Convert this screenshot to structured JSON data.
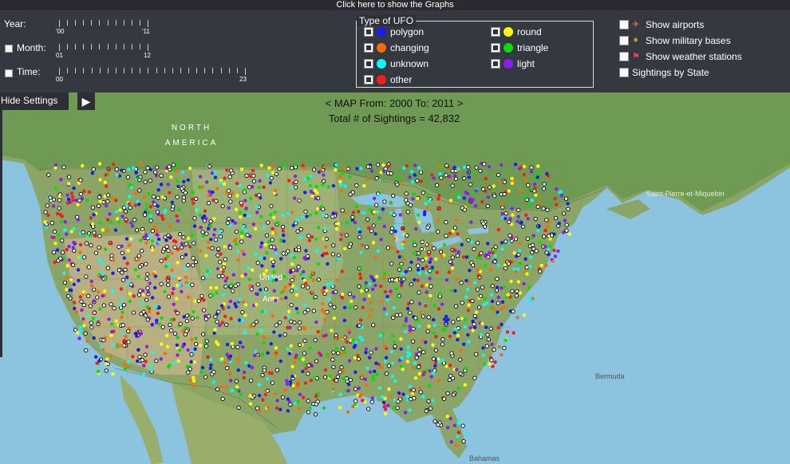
{
  "header": {
    "graphs_link": "Click here to show the Graphs"
  },
  "filters": {
    "year": {
      "label": "Year:",
      "min": "'00",
      "max": "'11"
    },
    "month": {
      "label": "Month:",
      "min": "01",
      "max": "12",
      "checked": false
    },
    "time": {
      "label": "Time:",
      "min": "00",
      "max": "23",
      "checked": false
    }
  },
  "ufo_types": {
    "legend": "Type of UFO",
    "items": [
      {
        "label": "polygon",
        "color": "#1a1aff"
      },
      {
        "label": "round",
        "color": "#ffff00"
      },
      {
        "label": "changing",
        "color": "#ff6a00"
      },
      {
        "label": "triangle",
        "color": "#00e000"
      },
      {
        "label": "unknown",
        "color": "#00ffff"
      },
      {
        "label": "light",
        "color": "#8a1aff"
      },
      {
        "label": "other",
        "color": "#ff1a1a"
      }
    ]
  },
  "layers": {
    "airports": "Show airports",
    "military": "Show military bases",
    "weather": "Show weather stations",
    "by_state": "Sightings by State"
  },
  "controls": {
    "hide_settings": "Hide Settings",
    "play": "▶"
  },
  "map": {
    "title_line1": "< MAP From: 2000 To: 2011 >",
    "title_line2": "Total # of Sightings = 42,832",
    "labels": {
      "north": "NORTH",
      "america": "AMERICA",
      "saint_pierre": "Saint-Pierre-et-Miquelon",
      "bermuda": "Bermuda",
      "bahamas": "Bahamas",
      "united": "United",
      "states_partial": "Ame"
    }
  }
}
